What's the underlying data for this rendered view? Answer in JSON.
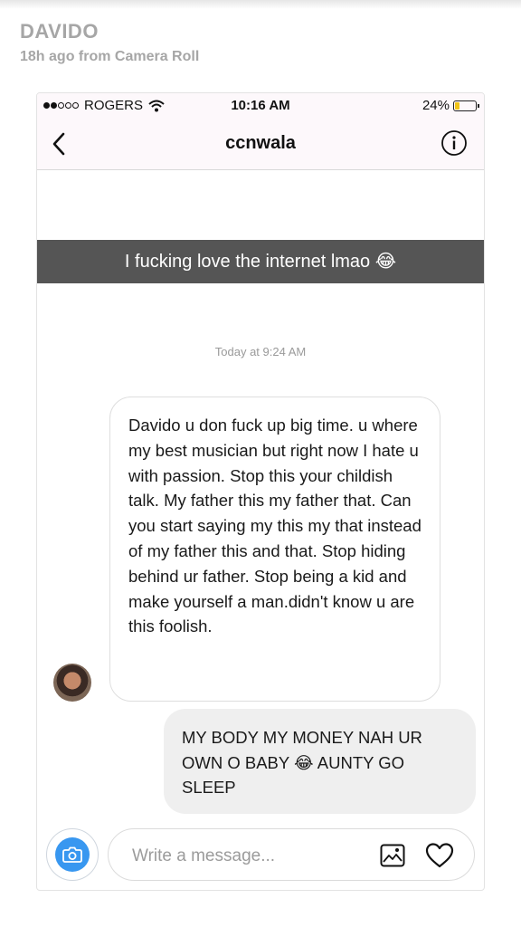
{
  "story": {
    "name": "DAVIDO",
    "meta": "18h ago from Camera Roll"
  },
  "status_bar": {
    "carrier": "ROGERS",
    "time": "10:16 AM",
    "battery_text": "24%",
    "battery_level": 0.24,
    "signal_bars": 2,
    "icons": [
      "signal-dots-icon",
      "wifi-icon",
      "battery-icon"
    ]
  },
  "navbar": {
    "title": "ccnwala",
    "back_icon": "chevron-left-icon",
    "info_icon": "info-circle-icon"
  },
  "caption": "I fucking love the internet lmao 😂",
  "timestamp": "Today at 9:24 AM",
  "messages": [
    {
      "direction": "incoming",
      "text": "Davido u don fuck up big time. u where my best musician but right now I hate u with passion. Stop this your childish talk. My father this my father that. Can you start saying my this my that instead of my father this and that. Stop hiding behind ur father. Stop being a kid and make yourself a man.didn't know u are this foolish."
    },
    {
      "direction": "outgoing",
      "text": "MY BODY MY MONEY NAH UR OWN O BABY 😂  AUNTY GO SLEEP"
    }
  ],
  "composer": {
    "placeholder": "Write a message...",
    "value": "",
    "camera_icon": "camera-icon",
    "gallery_icon": "image-icon",
    "like_icon": "heart-icon"
  },
  "colors": {
    "accent": "#3897f0",
    "caption_bg": "#464646",
    "battery": "#f0c419",
    "outgoing_bubble": "#efefef",
    "story_text": "#a6a6a6"
  }
}
